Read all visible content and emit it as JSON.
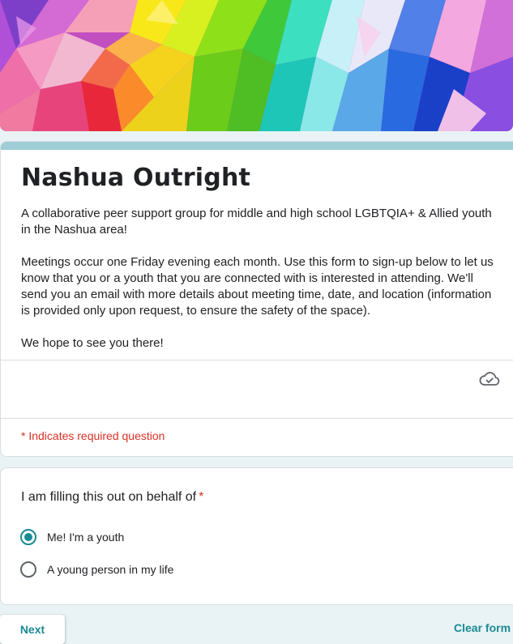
{
  "form": {
    "title": "Nashua Outright",
    "description": [
      "A collaborative peer support group for middle and high school LGBTQIA+ & Allied youth in the Nashua area!",
      "Meetings occur one Friday evening each month. Use this form to sign-up below to let us know that you or a youth that you are connected with is interested in attending. We'll send you an email with more details about meeting time, date, and location (information is provided only upon request, to ensure the safety of the space).",
      "We hope to see you there!"
    ],
    "required_note": "* Indicates required question",
    "save_status_icon": "cloud-check-icon"
  },
  "question": {
    "text": "I am filling this out on behalf of",
    "required_marker": "*",
    "options": [
      {
        "label": "Me! I'm a youth",
        "selected": true
      },
      {
        "label": "A young person in my life",
        "selected": false
      }
    ]
  },
  "actions": {
    "next_label": "Next",
    "clear_label": "Clear form"
  },
  "colors": {
    "accent": "#1a8a95",
    "header_accent": "#9fcdd5",
    "required": "#d93025",
    "background": "#e9f3f5"
  }
}
